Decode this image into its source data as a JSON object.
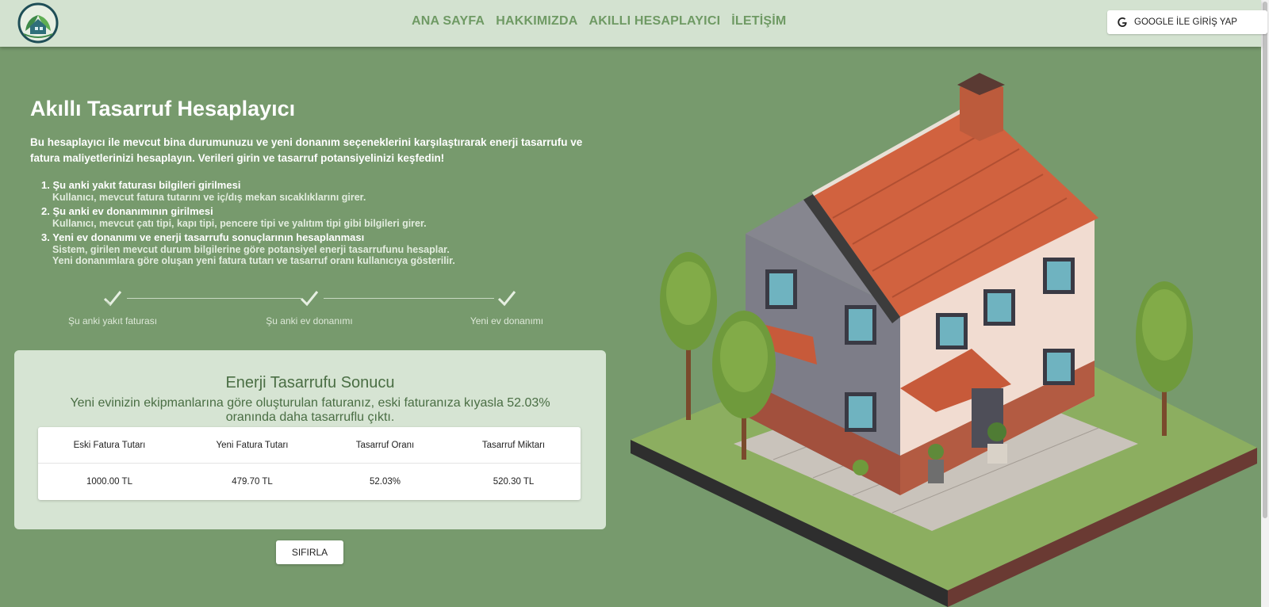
{
  "header": {
    "nav": [
      "ANA SAYFA",
      "HAKKIMIZDA",
      "AKILLI HESAPLAYICI",
      "İLETİŞİM"
    ],
    "login_label": "GOOGLE İLE GİRİŞ YAP"
  },
  "main": {
    "title": "Akıllı Tasarruf Hesaplayıcı",
    "intro": "Bu hesaplayıcı ile mevcut bina durumunuzu ve yeni donanım seçeneklerini karşılaştırarak enerji tasarrufu ve fatura maliyetlerinizi hesaplayın. Verileri girin ve tasarruf potansiyelinizi keşfedin!",
    "steps": [
      {
        "title": "1. Şu anki yakıt faturası bilgileri girilmesi",
        "desc": [
          "Kullanıcı, mevcut fatura tutarını ve iç/dış mekan sıcaklıklarını girer."
        ]
      },
      {
        "title": "2. Şu anki ev donanımının girilmesi",
        "desc": [
          "Kullanıcı, mevcut çatı tipi, kapı tipi, pencere tipi ve yalıtım tipi gibi bilgileri girer."
        ]
      },
      {
        "title": "3. Yeni ev donanımı ve enerji tasarrufu sonuçlarının hesaplanması",
        "desc": [
          "Sistem, girilen mevcut durum bilgilerine göre potansiyel enerji tasarrufunu hesaplar.",
          "Yeni donanımlara göre oluşan yeni fatura tutarı ve tasarruf oranı kullanıcıya gösterilir."
        ]
      }
    ],
    "stepper": [
      "Şu anki yakıt faturası",
      "Şu anki ev donanımı",
      "Yeni ev donanımı"
    ]
  },
  "result": {
    "title": "Enerji Tasarrufu Sonucu",
    "message": "Yeni evinizin ekipmanlarına göre oluşturulan faturanız, eski faturanıza kıyasla 52.03% oranında daha tasarruflu çıktı.",
    "columns": [
      "Eski Fatura Tutarı",
      "Yeni Fatura Tutarı",
      "Tasarruf Oranı",
      "Tasarruf Miktarı"
    ],
    "values": [
      "1000.00 TL",
      "479.70 TL",
      "52.03%",
      "520.30 TL"
    ]
  },
  "reset_label": "SIFIRLA",
  "colors": {
    "background": "#779a6d",
    "header": "#d3e2d0",
    "nav_text": "#6f9a64",
    "card": "#d6e4d3"
  }
}
